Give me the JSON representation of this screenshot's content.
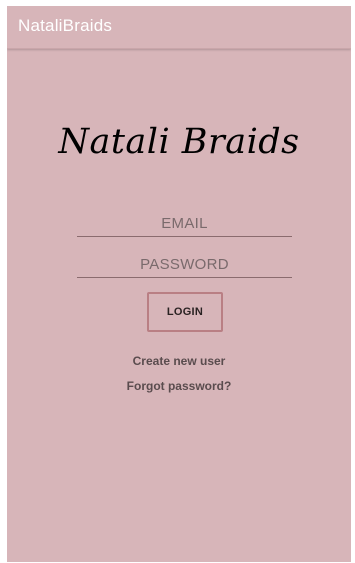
{
  "app_bar": {
    "title": "NataliBraids"
  },
  "brand": {
    "name": "Natali Braids"
  },
  "form": {
    "email_placeholder": "EMAIL",
    "password_placeholder": "PASSWORD",
    "login_label": "LOGIN"
  },
  "links": {
    "create_user": "Create new user",
    "forgot_password": "Forgot password?"
  },
  "colors": {
    "background": "#d7b5b9",
    "button_border": "#b97f84"
  }
}
